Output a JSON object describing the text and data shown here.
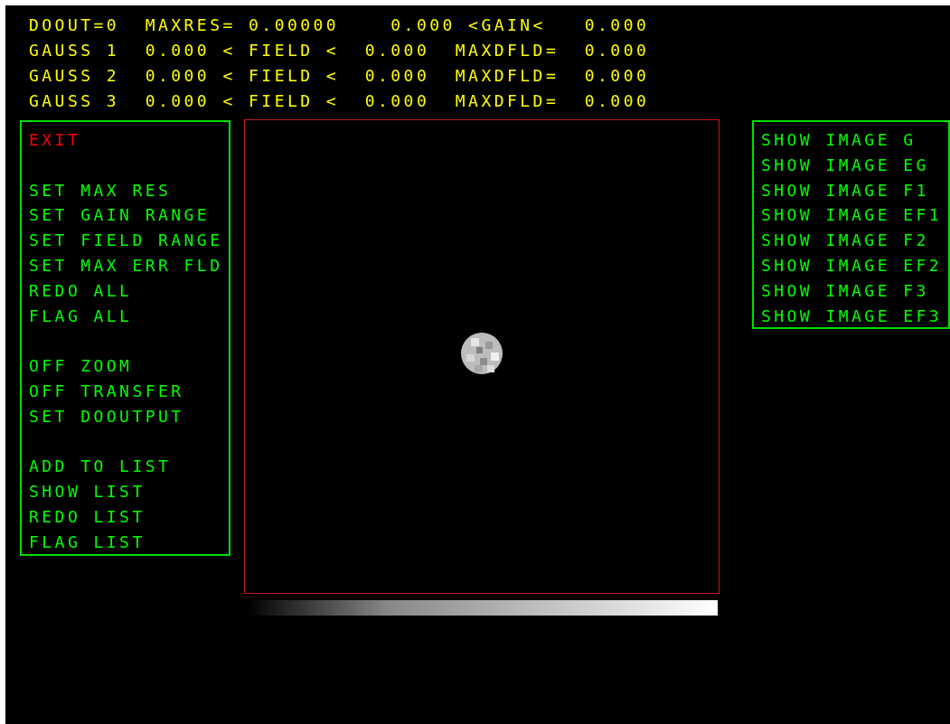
{
  "header": {
    "rows": [
      "DOOUT=0  MAXRES= 0.00000    0.000 <GAIN<   0.000",
      "GAUSS 1  0.000 < FIELD <  0.000  MAXDFLD=  0.000",
      "GAUSS 2  0.000 < FIELD <  0.000  MAXDFLD=  0.000",
      "GAUSS 3  0.000 < FIELD <  0.000  MAXDFLD=  0.000"
    ]
  },
  "left_menu": {
    "groups": [
      {
        "items": [
          {
            "label": "EXIT",
            "color": "#ff0000"
          }
        ]
      },
      {
        "items": [
          {
            "label": "SET MAX RES",
            "color": "#00ff00"
          },
          {
            "label": "SET GAIN RANGE",
            "color": "#00ff00"
          },
          {
            "label": "SET FIELD RANGE",
            "color": "#00ff00"
          },
          {
            "label": "SET MAX ERR FLD",
            "color": "#00ff00"
          },
          {
            "label": "REDO ALL",
            "color": "#00ff00"
          },
          {
            "label": "FLAG ALL",
            "color": "#00ff00"
          }
        ]
      },
      {
        "items": [
          {
            "label": "OFF ZOOM",
            "color": "#00ff00"
          },
          {
            "label": "OFF TRANSFER",
            "color": "#00ff00"
          },
          {
            "label": "SET DOOUTPUT",
            "color": "#00ff00"
          }
        ]
      },
      {
        "items": [
          {
            "label": "ADD TO LIST",
            "color": "#00ff00"
          },
          {
            "label": "SHOW LIST",
            "color": "#00ff00"
          },
          {
            "label": "REDO LIST",
            "color": "#00ff00"
          },
          {
            "label": "FLAG LIST",
            "color": "#00ff00"
          }
        ]
      }
    ]
  },
  "right_menu": {
    "items": [
      "SHOW IMAGE G",
      "SHOW IMAGE EG",
      "SHOW IMAGE F1",
      "SHOW IMAGE EF1",
      "SHOW IMAGE F2",
      "SHOW IMAGE EF2",
      "SHOW IMAGE F3",
      "SHOW IMAGE EF3"
    ]
  }
}
